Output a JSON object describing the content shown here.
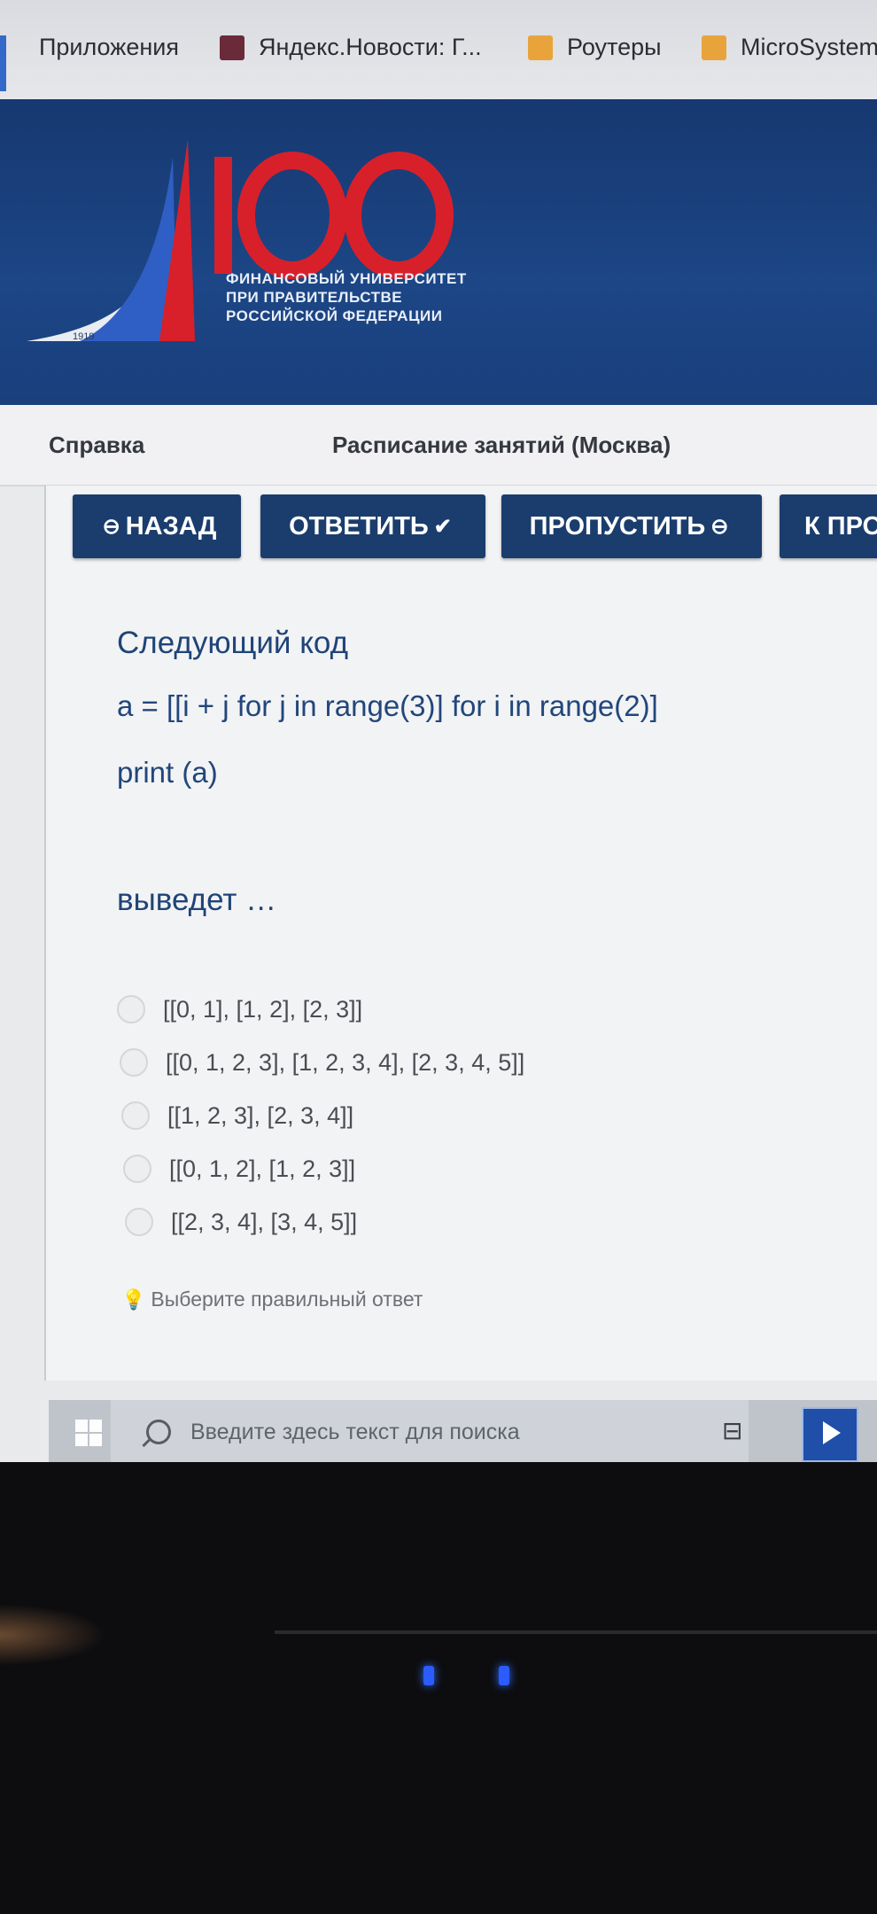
{
  "bookmarks": [
    {
      "label": "Приложения",
      "icon": "apps-grid-icon"
    },
    {
      "label": "Яндекс.Новости: Г...",
      "icon": "news-favicon-icon"
    },
    {
      "label": "Роутеры",
      "icon": "folder-icon"
    },
    {
      "label": "MicroSystem",
      "icon": "folder-icon"
    }
  ],
  "banner": {
    "logo_number": "100",
    "logo_year": "1919",
    "university_line1": "ФИНАНСОВЫЙ УНИВЕРСИТЕТ",
    "university_line2": "ПРИ ПРАВИТЕЛЬСТВЕ",
    "university_line3": "РОССИЙСКОЙ ФЕДЕРАЦИИ"
  },
  "nav": {
    "help": "Справка",
    "schedule": "Расписание занятий (Москва)"
  },
  "buttons": {
    "back": "НАЗАД",
    "answer": "ОТВЕТИТЬ",
    "skip": "ПРОПУСТИТЬ",
    "next_partial": "К ПРО"
  },
  "question": {
    "intro": "Следующий код",
    "code_line1": "a = [[i + j for j in range(3)] for i in range(2)]",
    "code_line2": "print (a)",
    "prompt": "выведет …"
  },
  "options": [
    "[[0, 1], [1, 2], [2, 3]]",
    "[[0, 1, 2, 3], [1, 2, 3, 4], [2, 3, 4, 5]]",
    "[[1, 2, 3], [2, 3, 4]]",
    "[[0, 1, 2], [1, 2, 3]]",
    "[[2, 3, 4], [3, 4, 5]]"
  ],
  "hint": "Выберите правильный ответ",
  "taskbar": {
    "search_placeholder": "Введите здесь текст для поиска"
  },
  "colors": {
    "banner": "#1c4686",
    "button": "#1b3d6d",
    "question_text": "#1f4478",
    "logo_red": "#d8202a"
  }
}
